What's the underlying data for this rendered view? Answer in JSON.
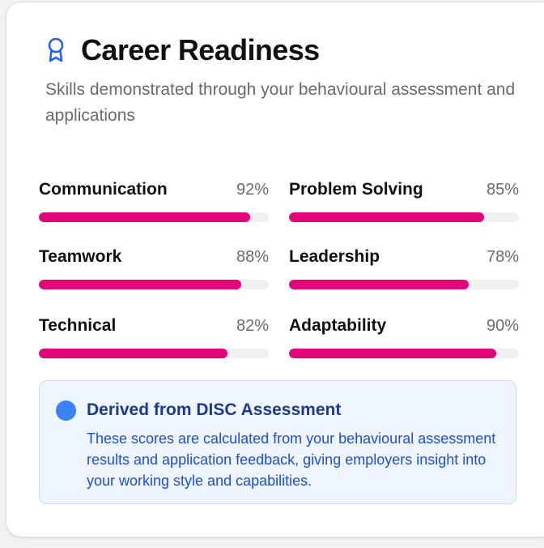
{
  "card": {
    "title": "Career Readiness",
    "subtitle": "Skills demonstrated through your behavioural assessment and applications",
    "icon": "award-ribbon-icon"
  },
  "skills": [
    {
      "name": "Communication",
      "percent_label": "92%",
      "value": 92
    },
    {
      "name": "Problem Solving",
      "percent_label": "85%",
      "value": 85
    },
    {
      "name": "Teamwork",
      "percent_label": "88%",
      "value": 88
    },
    {
      "name": "Leadership",
      "percent_label": "78%",
      "value": 78
    },
    {
      "name": "Technical",
      "percent_label": "82%",
      "value": 82
    },
    {
      "name": "Adaptability",
      "percent_label": "90%",
      "value": 90
    }
  ],
  "info": {
    "title": "Derived from DISC Assessment",
    "text": "These scores are calculated from your behavioural assessment results and application feedback, giving employers insight into your working style and capabilities.",
    "icon": "info-dot-icon"
  },
  "colors": {
    "accent": "#e3057a",
    "track": "#f0f0f0",
    "info_bg": "#eef5ff",
    "info_title": "#1e3a8a",
    "info_text": "#1d4ed8",
    "icon_blue": "#2563eb"
  }
}
